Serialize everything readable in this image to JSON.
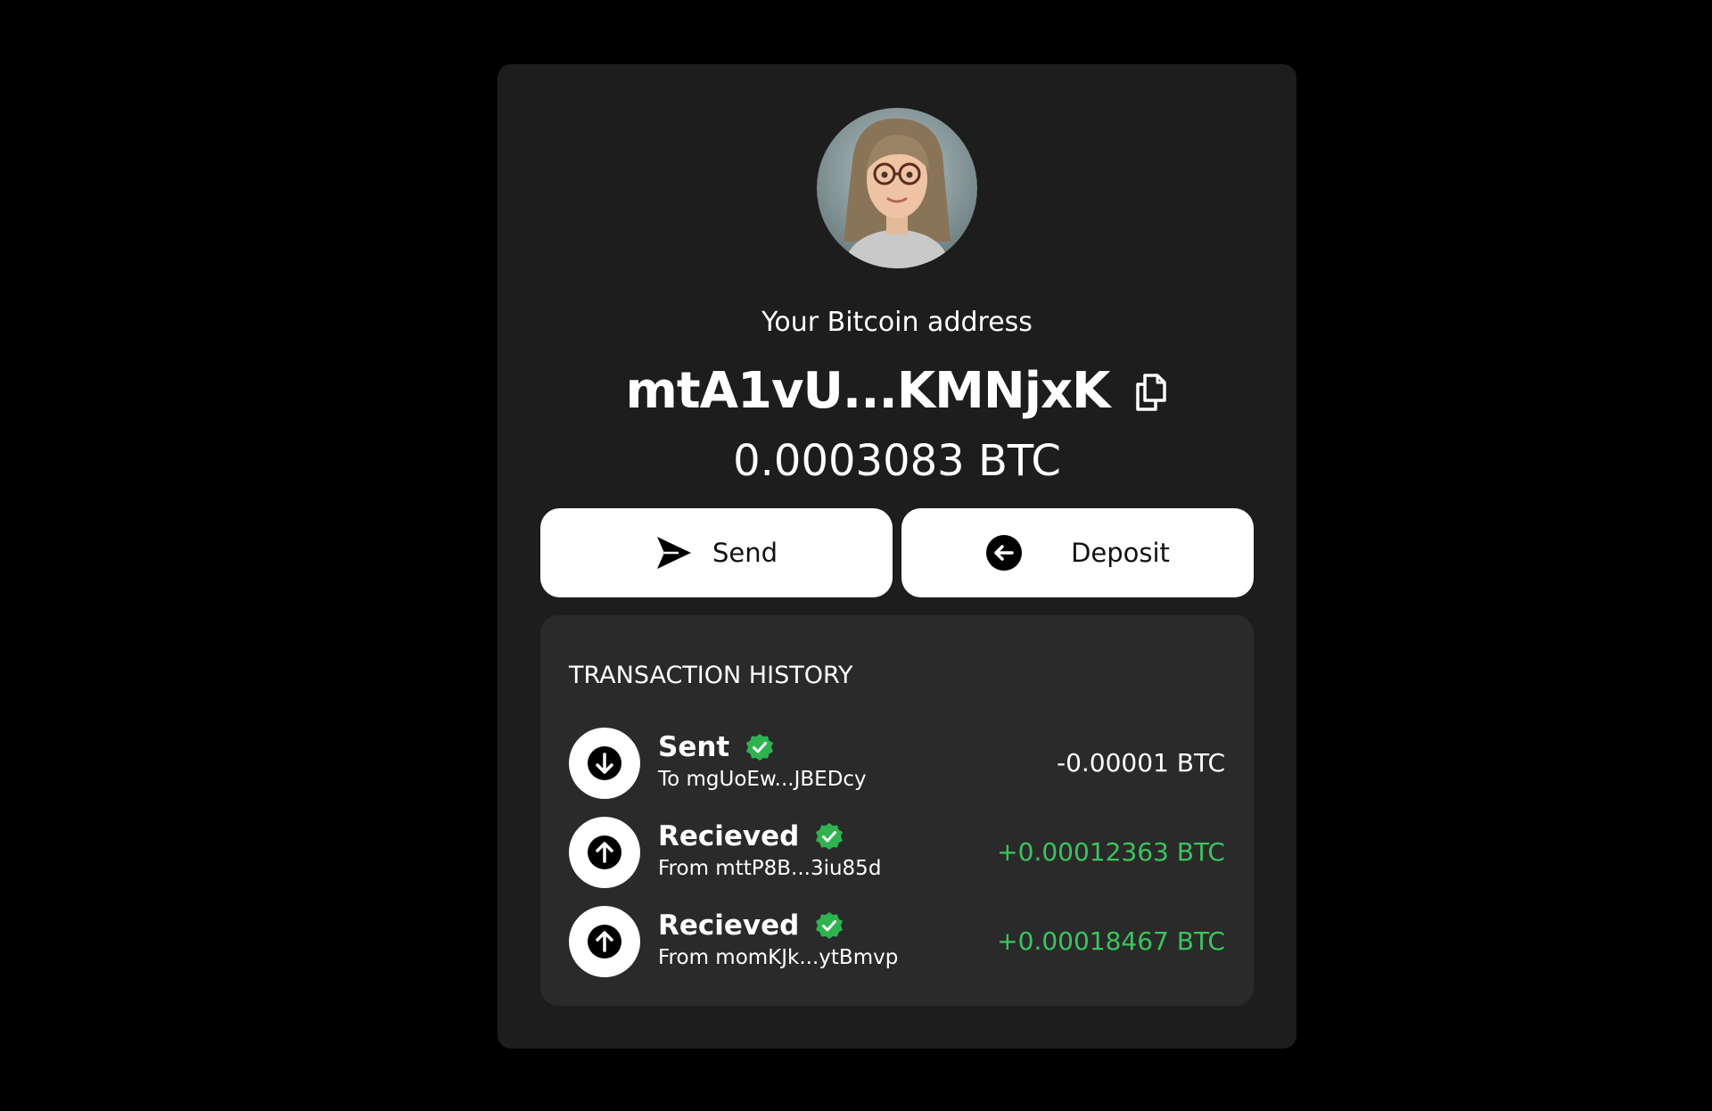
{
  "wallet": {
    "address_label": "Your Bitcoin address",
    "address": "mtA1vU...KMNjxK",
    "balance": "0.0003083 BTC"
  },
  "actions": {
    "send_label": "Send",
    "deposit_label": "Deposit"
  },
  "history": {
    "title": "TRANSACTION HISTORY",
    "transactions": [
      {
        "title": "Sent",
        "counterparty": "To mgUoEw...JBEDcy",
        "amount": "-0.00001 BTC",
        "direction": "arrow-down-icon"
      },
      {
        "title": "Recieved",
        "counterparty": "From mttP8B...3iu85d",
        "amount": "+0.00012363 BTC",
        "direction": "arrow-up-icon"
      },
      {
        "title": "Recieved",
        "counterparty": "From momKJk...ytBmvp",
        "amount": "+0.00018467 BTC",
        "direction": "arrow-up-icon"
      }
    ]
  },
  "colors": {
    "background": "#000000",
    "card": "#1d1d1e",
    "panel": "#2a2a2a",
    "positive": "#3bc45e",
    "verified": "#2fb350",
    "text": "#ffffff"
  }
}
